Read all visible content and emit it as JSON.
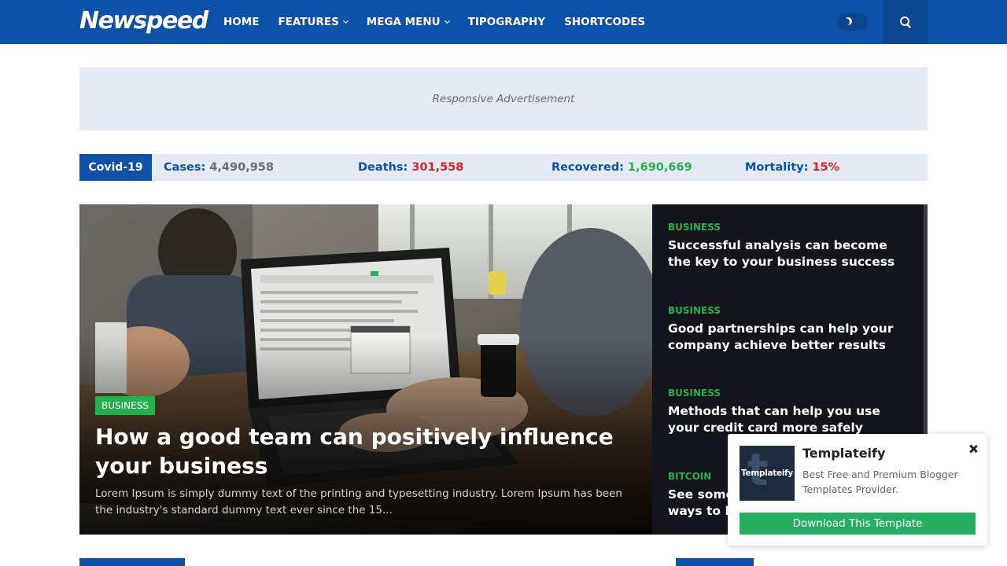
{
  "header": {
    "logo": "Newspeed",
    "nav": [
      {
        "label": "HOME"
      },
      {
        "label": "FEATURES"
      },
      {
        "label": "MEGA MENU"
      },
      {
        "label": "TIPOGRAPHY"
      },
      {
        "label": "SHORTCODES"
      }
    ]
  },
  "ad": {
    "text": "Responsive Advertisement"
  },
  "covid": {
    "tag": "Covid-19",
    "stats": [
      {
        "label": "Cases:",
        "value": "4,490,958",
        "color": "#666e7a"
      },
      {
        "label": "Deaths:",
        "value": "301,558",
        "color": "#e0202a"
      },
      {
        "label": "Recovered:",
        "value": "1,690,669",
        "color": "#22b14c"
      },
      {
        "label": "Mortality:",
        "value": "15%",
        "color": "#e0202a"
      }
    ]
  },
  "featured": {
    "category": "BUSINESS",
    "title": "How a good team can positively influence your business",
    "excerpt": "Lorem Ipsum is simply dummy text of the printing and typesetting industry. Lorem Ipsum has been the industry's standard dummy text ever since the 15..."
  },
  "side_posts": [
    {
      "category": "BUSINESS",
      "title": "Successful analysis can become the key to your business success"
    },
    {
      "category": "BUSINESS",
      "title": "Good partnerships can help your company achieve better results"
    },
    {
      "category": "BUSINESS",
      "title": "Methods that can help you use your credit card more safely"
    },
    {
      "category": "BITCOIN",
      "title": "See some of the most important ways to be a good investor"
    }
  ],
  "popup": {
    "thumb_text": "Templateify",
    "name": "Templateify",
    "description": "Best Free and Premium Blogger Templates Provider.",
    "button": "Download This Template"
  }
}
